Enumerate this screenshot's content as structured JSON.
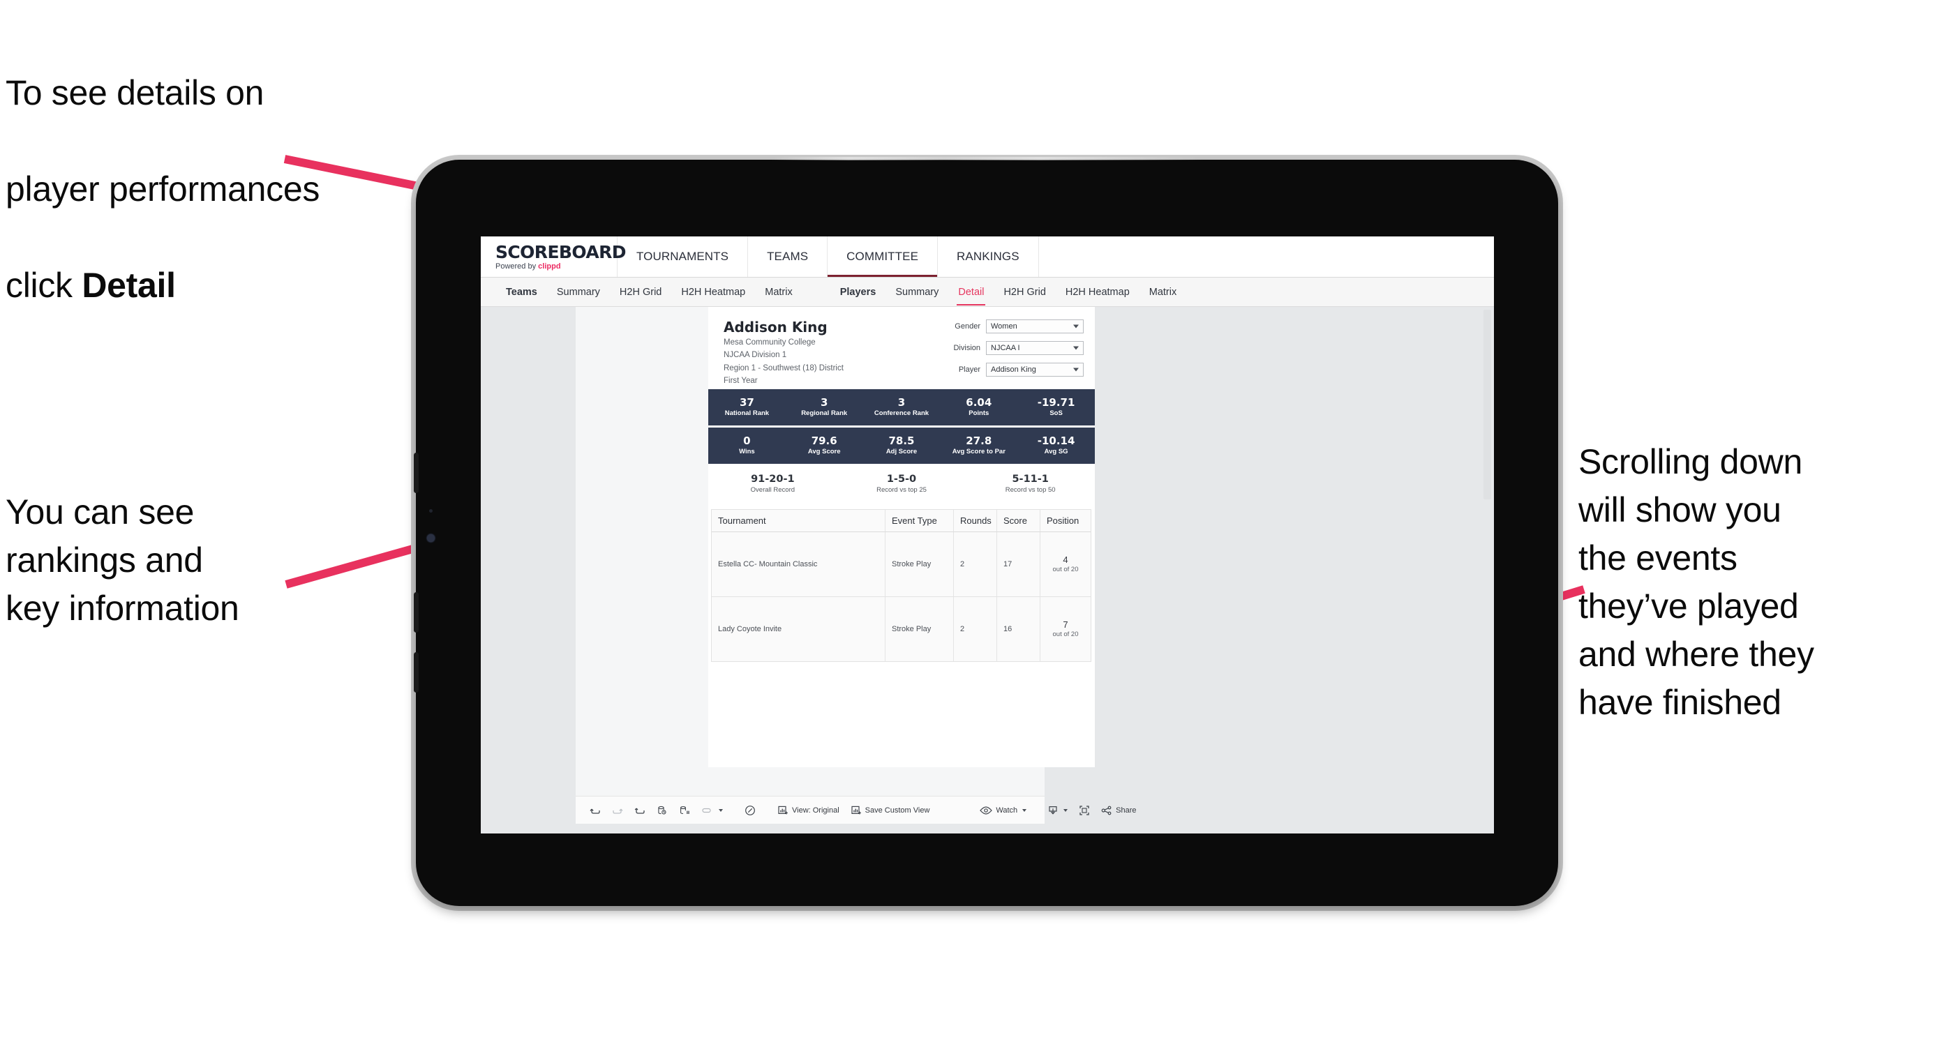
{
  "annotations": {
    "detail": {
      "line1": "To see details on",
      "line2": "player performances",
      "line3_prefix": "click ",
      "line3_bold": "Detail"
    },
    "rankings": "You can see\nrankings and\nkey information",
    "scrolling": "Scrolling down\nwill show you\nthe events\nthey’ve played\nand where they\nhave finished"
  },
  "accent_color": "#ec2c63",
  "arrow_color": "#e8315e",
  "band_color": "#303a51",
  "app": {
    "logo": {
      "main": "SCOREBOARD",
      "sub_prefix": "Powered by ",
      "sub_brand": "clippd"
    },
    "topnav": [
      {
        "label": "TOURNAMENTS",
        "active": false
      },
      {
        "label": "TEAMS",
        "active": false
      },
      {
        "label": "COMMITTEE",
        "active": true
      },
      {
        "label": "RANKINGS",
        "active": false
      }
    ],
    "subnav": {
      "teams_group": {
        "label": "Teams",
        "tabs": [
          "Summary",
          "H2H Grid",
          "H2H Heatmap",
          "Matrix"
        ]
      },
      "players_group": {
        "label": "Players",
        "tabs": [
          "Summary",
          "Detail",
          "H2H Grid",
          "H2H Heatmap",
          "Matrix"
        ],
        "selected": "Detail"
      }
    }
  },
  "player": {
    "name": "Addison King",
    "school": "Mesa Community College",
    "division": "NJCAA Division 1",
    "region": "Region 1 - Southwest (18) District",
    "year": "First Year"
  },
  "filters": [
    {
      "label": "Gender",
      "value": "Women"
    },
    {
      "label": "Division",
      "value": "NJCAA I"
    },
    {
      "label": "Player",
      "value": "Addison King"
    }
  ],
  "stats_band_1": [
    {
      "value": "37",
      "label": "National Rank"
    },
    {
      "value": "3",
      "label": "Regional Rank"
    },
    {
      "value": "3",
      "label": "Conference Rank"
    },
    {
      "value": "6.04",
      "label": "Points"
    },
    {
      "value": "-19.71",
      "label": "SoS"
    }
  ],
  "stats_band_2": [
    {
      "value": "0",
      "label": "Wins"
    },
    {
      "value": "79.6",
      "label": "Avg Score"
    },
    {
      "value": "78.5",
      "label": "Adj Score"
    },
    {
      "value": "27.8",
      "label": "Avg Score to Par"
    },
    {
      "value": "-10.14",
      "label": "Avg SG"
    }
  ],
  "records": [
    {
      "value": "91-20-1",
      "label": "Overall Record"
    },
    {
      "value": "1-5-0",
      "label": "Record vs top 25"
    },
    {
      "value": "5-11-1",
      "label": "Record vs top 50"
    }
  ],
  "events_table": {
    "columns": [
      "Tournament",
      "Event Type",
      "Rounds",
      "Score",
      "Position"
    ],
    "rows": [
      {
        "tournament": "Estella CC- Mountain Classic",
        "event_type": "Stroke Play",
        "rounds": "2",
        "score": "17",
        "position_value": "4",
        "position_out_of": "out of 20"
      },
      {
        "tournament": "Lady Coyote Invite",
        "event_type": "Stroke Play",
        "rounds": "2",
        "score": "16",
        "position_value": "7",
        "position_out_of": "out of 20"
      }
    ]
  },
  "toolbar": {
    "view_label": "View: Original",
    "save_label": "Save Custom View",
    "watch_label": "Watch",
    "share_label": "Share"
  }
}
